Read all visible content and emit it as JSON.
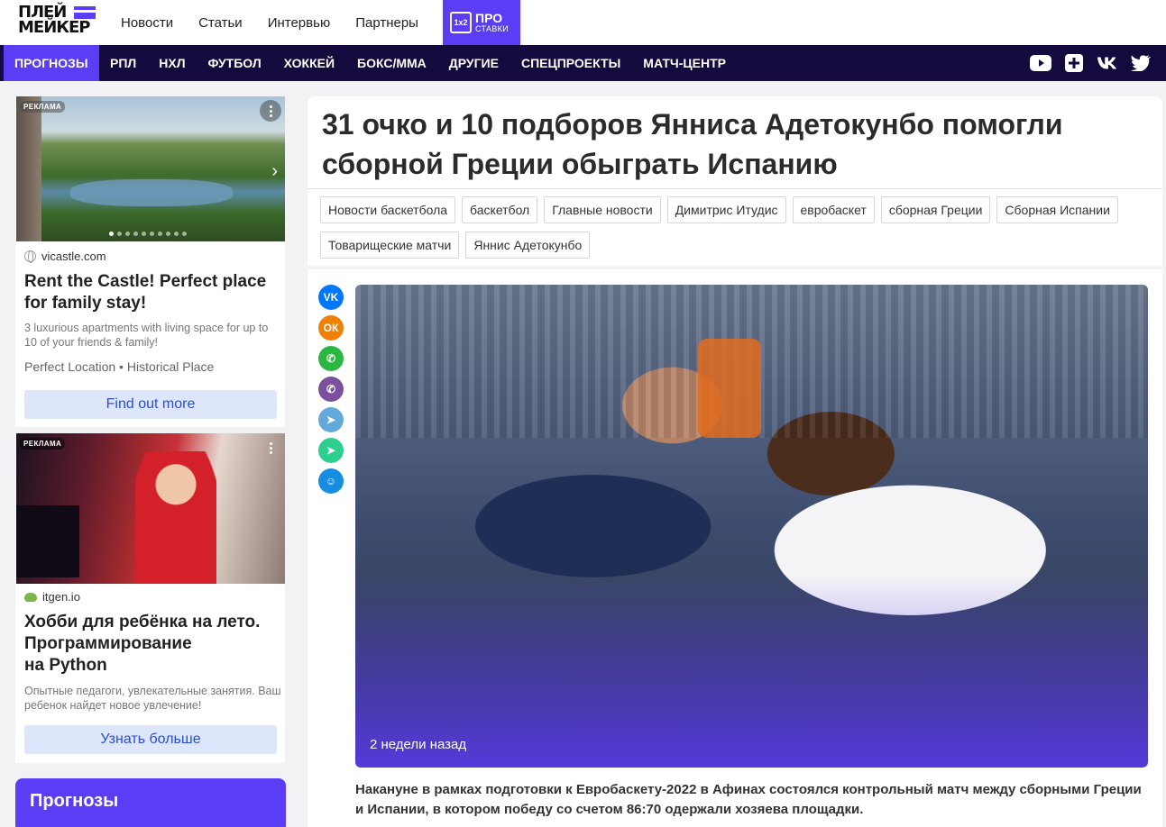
{
  "header": {
    "logo_line1": "ПЛЕЙ",
    "logo_line2": "МЕЙКЕР",
    "nav": [
      "Новости",
      "Статьи",
      "Интервью",
      "Партнеры"
    ],
    "pro": {
      "icon_text": "1x2",
      "line1": "ПРО",
      "line2": "СТАВКИ"
    }
  },
  "navbar": {
    "items": [
      "ПРОГНОЗЫ",
      "РПЛ",
      "НХЛ",
      "ФУТБОЛ",
      "ХОККЕЙ",
      "БОКС/ММА",
      "ДРУГИЕ",
      "СПЕЦПРОЕКТЫ",
      "МАТЧ-ЦЕНТР"
    ],
    "active_index": 0,
    "social_icons": [
      "youtube-icon",
      "plus-box-icon",
      "vk-icon",
      "twitter-icon"
    ]
  },
  "ads": [
    {
      "label": "РЕКЛАМА",
      "site": "vicastle.com",
      "title": "Rent the Castle! Perfect place for family stay!",
      "text": "3 luxurious apartments with living space for up to 10 of your friends & family!",
      "tags": "Perfect Location • Historical Place",
      "button": "Find out more"
    },
    {
      "label": "РЕКЛАМА",
      "site": "itgen.io",
      "title_line1": "Хобби для ребёнка на лето.",
      "title_line2": "Программирование",
      "title_line3": "на Python",
      "text": "Опытные педагоги, увлекательные занятия. Ваш ребенок найдет новое увлечение!",
      "button": "Узнать больше"
    }
  ],
  "sidebar_block": {
    "title": "Прогнозы"
  },
  "article": {
    "headline": "31 очко и 10 подборов Янниса Адетокунбо помогли сборной Греции обыграть Испанию",
    "tags": [
      "Новости баскетбола",
      "баскетбол",
      "Главные новости",
      "Димитрис Итудис",
      "евробаскет",
      "сборная Греции",
      "Сборная Испании",
      "Товарищеские матчи",
      "Яннис Адетокунбо"
    ],
    "share": [
      {
        "icon": "vk-icon",
        "glyph": "VK",
        "color": "#0077ff"
      },
      {
        "icon": "odnoklassniki-icon",
        "glyph": "ОК",
        "color": "#ee8208"
      },
      {
        "icon": "whatsapp-icon",
        "glyph": "✆",
        "color": "#2cb742"
      },
      {
        "icon": "viber-icon",
        "glyph": "✆",
        "color": "#7b519d"
      },
      {
        "icon": "telegram-icon",
        "glyph": "➤",
        "color": "#64a9dc"
      },
      {
        "icon": "messenger-icon",
        "glyph": "➤",
        "color": "#2ecf8e"
      },
      {
        "icon": "moimir-icon",
        "glyph": "☺",
        "color": "#168de2"
      }
    ],
    "photo_time": "2 недели назад",
    "lead": "Накануне в рамках подготовки к Евробаскету-2022 в Афинах состоялся контрольный матч между сборными Греции и Испании, в котором победу со счетом 86:70 одержали хозяева площадки."
  }
}
